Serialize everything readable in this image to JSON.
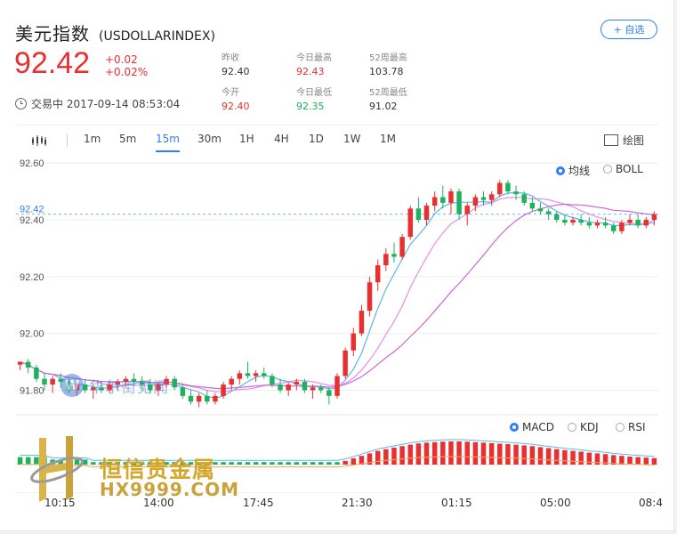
{
  "header": {
    "name_cn": "美元指数",
    "code": "(USDOLLARINDEX)",
    "add_label": "+ 自选",
    "price": "92.42",
    "change": "+0.02",
    "change_pct": "+0.02%",
    "status": "交易中 2017-09-14 08:53:04"
  },
  "stats": {
    "prev_close": {
      "label": "昨收",
      "value": "92.40"
    },
    "day_high": {
      "label": "今日最高",
      "value": "92.43"
    },
    "wk52_high": {
      "label": "52周最高",
      "value": "103.78"
    },
    "open": {
      "label": "今开",
      "value": "92.40"
    },
    "day_low": {
      "label": "今日最低",
      "value": "92.35"
    },
    "wk52_low": {
      "label": "52周最低",
      "value": "91.02"
    }
  },
  "toolbar": {
    "tabs": [
      "1m",
      "5m",
      "15m",
      "30m",
      "1H",
      "4H",
      "1D",
      "1W",
      "1M"
    ],
    "active_tab": "15m",
    "draw_label": "绘图"
  },
  "overlays": {
    "ma": "均线",
    "boll": "BOLL",
    "ma_selected": true
  },
  "indicators": {
    "macd": "MACD",
    "kdj": "KDJ",
    "rsi": "RSI",
    "selected": "MACD"
  },
  "watermarks": {
    "brand1": "华尔街见闻",
    "brand2_cn": "恒信贵金属",
    "brand2_en": "HX9999.COM"
  },
  "colors": {
    "up": "#e93030",
    "down": "#1db25c",
    "accent": "#2e7cf6",
    "ma_fast": "#5bb7ea",
    "ma_slow": "#c86ad3"
  },
  "chart_data": {
    "type": "candlestick",
    "y_ticks": [
      "92.60",
      "92.40",
      "92.20",
      "92.00",
      "91.80"
    ],
    "ylim": [
      91.72,
      92.61
    ],
    "current_price_label": "92.42",
    "x_ticks": [
      "10:15",
      "14:00",
      "17:45",
      "21:30",
      "01:15",
      "05:00",
      "08:4"
    ],
    "candles": [
      [
        91.89,
        91.9,
        91.87,
        91.9
      ],
      [
        91.9,
        91.91,
        91.86,
        91.88
      ],
      [
        91.88,
        91.89,
        91.83,
        91.84
      ],
      [
        91.84,
        91.86,
        91.8,
        91.82
      ],
      [
        91.82,
        91.85,
        91.79,
        91.84
      ],
      [
        91.84,
        91.86,
        91.81,
        91.83
      ],
      [
        91.83,
        91.84,
        91.79,
        91.8
      ],
      [
        91.8,
        91.83,
        91.78,
        91.82
      ],
      [
        91.82,
        91.84,
        91.79,
        91.8
      ],
      [
        91.8,
        91.82,
        91.77,
        91.81
      ],
      [
        91.81,
        91.83,
        91.79,
        91.8
      ],
      [
        91.8,
        91.83,
        91.79,
        91.82
      ],
      [
        91.82,
        91.84,
        91.8,
        91.83
      ],
      [
        91.83,
        91.85,
        91.81,
        91.84
      ],
      [
        91.84,
        91.86,
        91.82,
        91.83
      ],
      [
        91.83,
        91.85,
        91.8,
        91.82
      ],
      [
        91.82,
        91.84,
        91.79,
        91.8
      ],
      [
        91.8,
        91.83,
        91.78,
        91.82
      ],
      [
        91.82,
        91.85,
        91.81,
        91.84
      ],
      [
        91.84,
        91.85,
        91.8,
        91.81
      ],
      [
        91.81,
        91.82,
        91.77,
        91.78
      ],
      [
        91.78,
        91.8,
        91.75,
        91.76
      ],
      [
        91.76,
        91.79,
        91.74,
        91.78
      ],
      [
        91.78,
        91.8,
        91.75,
        91.76
      ],
      [
        91.76,
        91.79,
        91.75,
        91.78
      ],
      [
        91.78,
        91.83,
        91.77,
        91.82
      ],
      [
        91.82,
        91.85,
        91.8,
        91.84
      ],
      [
        91.84,
        91.87,
        91.82,
        91.86
      ],
      [
        91.86,
        91.9,
        91.84,
        91.85
      ],
      [
        91.85,
        91.87,
        91.83,
        91.86
      ],
      [
        91.86,
        91.88,
        91.84,
        91.85
      ],
      [
        91.85,
        91.86,
        91.81,
        91.82
      ],
      [
        91.82,
        91.84,
        91.79,
        91.8
      ],
      [
        91.8,
        91.83,
        91.78,
        91.82
      ],
      [
        91.82,
        91.84,
        91.8,
        91.83
      ],
      [
        91.83,
        91.84,
        91.79,
        91.8
      ],
      [
        91.8,
        91.82,
        91.77,
        91.81
      ],
      [
        91.81,
        91.82,
        91.79,
        91.8
      ],
      [
        91.8,
        91.81,
        91.75,
        91.78
      ],
      [
        91.78,
        91.86,
        91.77,
        91.85
      ],
      [
        91.85,
        91.95,
        91.84,
        91.94
      ],
      [
        91.94,
        92.02,
        91.92,
        92.0
      ],
      [
        92.0,
        92.1,
        91.99,
        92.08
      ],
      [
        92.08,
        92.2,
        92.06,
        92.18
      ],
      [
        92.18,
        92.26,
        92.15,
        92.24
      ],
      [
        92.24,
        92.3,
        92.22,
        92.28
      ],
      [
        92.28,
        92.32,
        92.25,
        92.27
      ],
      [
        92.27,
        92.35,
        92.26,
        92.34
      ],
      [
        92.34,
        92.45,
        92.33,
        92.44
      ],
      [
        92.44,
        92.48,
        92.39,
        92.4
      ],
      [
        92.4,
        92.46,
        92.38,
        92.45
      ],
      [
        92.45,
        92.5,
        92.43,
        92.48
      ],
      [
        92.48,
        92.52,
        92.44,
        92.46
      ],
      [
        92.46,
        92.51,
        92.42,
        92.5
      ],
      [
        92.5,
        92.51,
        92.4,
        92.42
      ],
      [
        92.42,
        92.46,
        92.38,
        92.45
      ],
      [
        92.45,
        92.49,
        92.43,
        92.48
      ],
      [
        92.48,
        92.5,
        92.45,
        92.47
      ],
      [
        92.47,
        92.5,
        92.45,
        92.49
      ],
      [
        92.49,
        92.54,
        92.48,
        92.53
      ],
      [
        92.53,
        92.54,
        92.49,
        92.5
      ],
      [
        92.5,
        92.52,
        92.47,
        92.49
      ],
      [
        92.49,
        92.5,
        92.45,
        92.46
      ],
      [
        92.46,
        92.48,
        92.43,
        92.44
      ],
      [
        92.44,
        92.46,
        92.42,
        92.43
      ],
      [
        92.43,
        92.44,
        92.4,
        92.42
      ],
      [
        92.42,
        92.43,
        92.39,
        92.4
      ],
      [
        92.4,
        92.42,
        92.38,
        92.39
      ],
      [
        92.39,
        92.41,
        92.38,
        92.4
      ],
      [
        92.4,
        92.42,
        92.38,
        92.39
      ],
      [
        92.39,
        92.41,
        92.37,
        92.38
      ],
      [
        92.38,
        92.4,
        92.37,
        92.39
      ],
      [
        92.39,
        92.41,
        92.37,
        92.38
      ],
      [
        92.38,
        92.39,
        92.35,
        92.36
      ],
      [
        92.36,
        92.4,
        92.35,
        92.39
      ],
      [
        92.39,
        92.42,
        92.38,
        92.4
      ],
      [
        92.4,
        92.42,
        92.37,
        92.38
      ],
      [
        92.38,
        92.41,
        92.37,
        92.4
      ],
      [
        92.4,
        92.43,
        92.38,
        92.42
      ]
    ],
    "macd_hist": [
      0.3,
      0.3,
      0.3,
      0.3,
      0.2,
      0.2,
      0.2,
      0.2,
      0.2,
      0.1,
      0.1,
      0.1,
      0.1,
      0.1,
      0.1,
      0.1,
      0.1,
      0.1,
      0.1,
      0.1,
      0.1,
      0.1,
      0.1,
      0.1,
      0.1,
      0.1,
      0.1,
      0.1,
      0.1,
      0.1,
      0.1,
      0.1,
      0.1,
      0.1,
      0.1,
      0.1,
      0.1,
      0.1,
      0.1,
      0.1,
      0.15,
      0.25,
      0.35,
      0.45,
      0.55,
      0.62,
      0.68,
      0.74,
      0.8,
      0.85,
      0.88,
      0.9,
      0.92,
      0.93,
      0.93,
      0.92,
      0.9,
      0.88,
      0.86,
      0.84,
      0.82,
      0.8,
      0.77,
      0.74,
      0.7,
      0.66,
      0.62,
      0.58,
      0.55,
      0.52,
      0.48,
      0.45,
      0.42,
      0.38,
      0.35,
      0.32,
      0.3,
      0.28,
      0.26
    ]
  }
}
